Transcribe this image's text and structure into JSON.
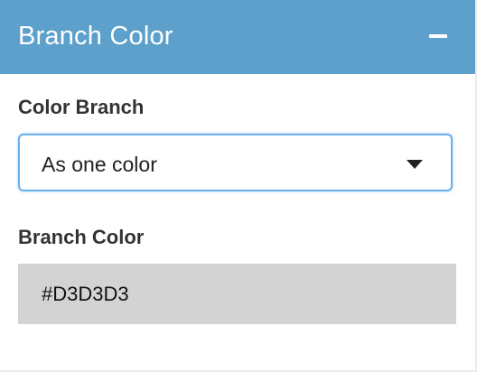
{
  "panel": {
    "title": "Branch Color",
    "collapse_icon": "minus-icon",
    "header_color": "#5ca0cb"
  },
  "color_branch": {
    "label": "Color Branch",
    "selected": "As one color",
    "caret_icon": "caret-down-icon"
  },
  "branch_color": {
    "label": "Branch Color",
    "value": "#D3D3D3",
    "swatch": "#d3d3d3"
  }
}
